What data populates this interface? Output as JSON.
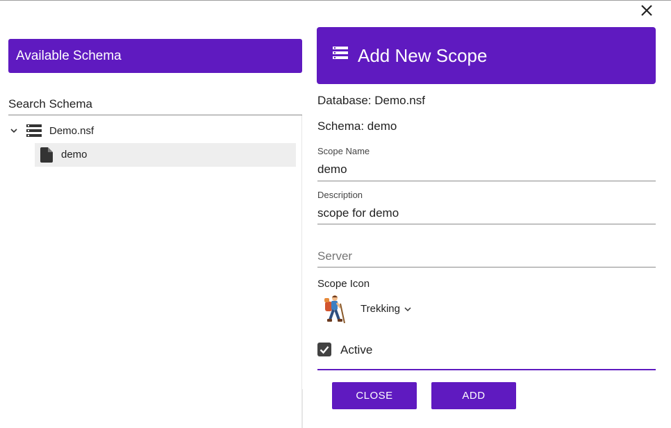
{
  "dialog": {
    "close_icon": "close-icon"
  },
  "left_panel": {
    "header_title": "Available Schema",
    "search_label": "Search Schema",
    "tree": {
      "database": {
        "label": "Demo.nsf",
        "icon": "database-icon",
        "expanded": true
      },
      "schemas": [
        {
          "label": "demo",
          "icon": "file-icon",
          "selected": true
        }
      ]
    }
  },
  "right_panel": {
    "header_title": "Add New Scope",
    "header_icon": "list-icon",
    "database_line": "Database: Demo.nsf",
    "schema_line": "Schema: demo",
    "scope_name": {
      "label": "Scope Name",
      "value": "demo"
    },
    "description": {
      "label": "Description",
      "value": "scope for demo"
    },
    "server": {
      "placeholder": "Server",
      "value": ""
    },
    "scope_icon": {
      "label": "Scope Icon",
      "selected": "Trekking",
      "icon": "trekking-icon"
    },
    "active": {
      "label": "Active",
      "checked": true
    },
    "buttons": {
      "close": "CLOSE",
      "add": "ADD"
    }
  },
  "colors": {
    "accent": "#5f1ac0",
    "selected_row": "#eeeeee",
    "checkbox": "#424242"
  }
}
